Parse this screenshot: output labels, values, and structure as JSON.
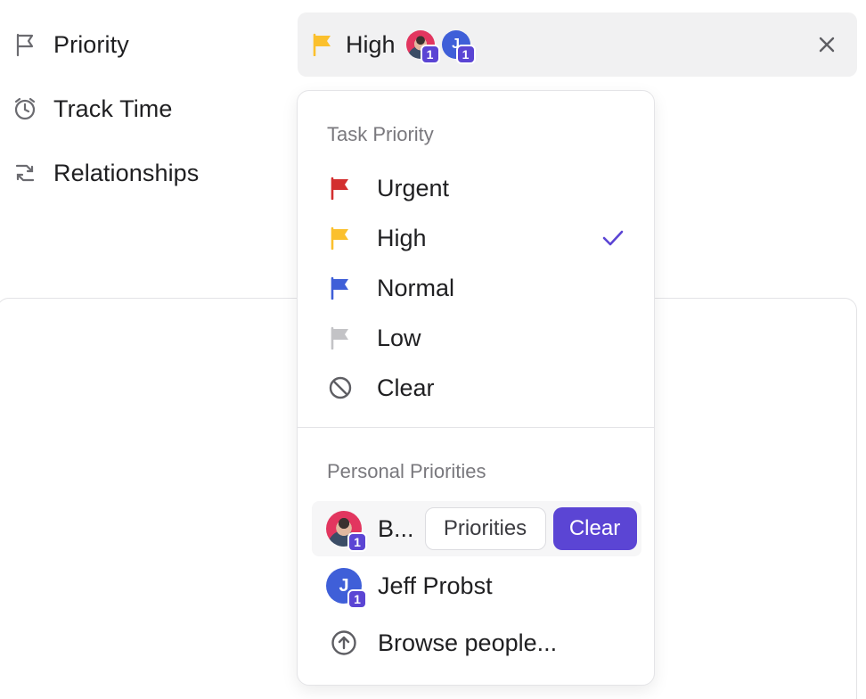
{
  "fields": [
    {
      "label": "Priority",
      "icon": "flag-outline-icon"
    },
    {
      "label": "Track Time",
      "icon": "alarm-clock-icon"
    },
    {
      "label": "Relationships",
      "icon": "relationship-arrows-icon"
    }
  ],
  "selector": {
    "value": "High",
    "flag_color": "#fbc02d",
    "avatar_badges": [
      "1",
      "1"
    ],
    "avatar_letter": "J"
  },
  "dropdown": {
    "task_priority_title": "Task Priority",
    "options": [
      {
        "label": "Urgent",
        "color": "#d32f2f"
      },
      {
        "label": "High",
        "color": "#fbc02d",
        "selected": true
      },
      {
        "label": "Normal",
        "color": "#3f5fd8"
      },
      {
        "label": "Low",
        "color": "#c3c3c6"
      },
      {
        "label": "Clear",
        "icon": "prohibited-icon"
      }
    ],
    "personal_priorities_title": "Personal Priorities",
    "people": [
      {
        "name": "B...",
        "badge": "1",
        "priorities_label": "Priorities",
        "clear_label": "Clear"
      },
      {
        "name": "Jeff Probst",
        "badge": "1",
        "letter": "J"
      }
    ],
    "browse_label": "Browse people...",
    "accent": "#5b45d4"
  }
}
